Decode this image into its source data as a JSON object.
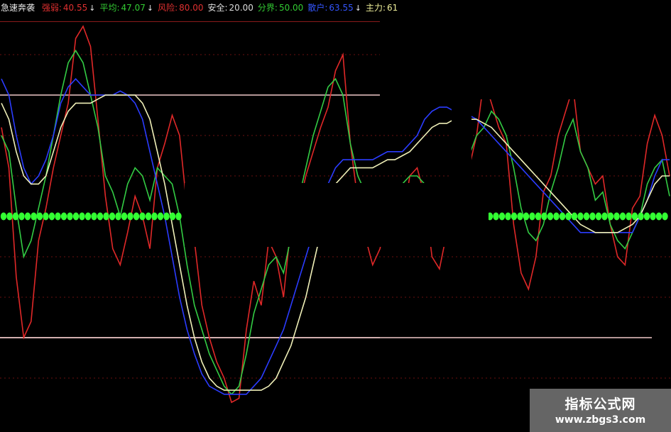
{
  "header": {
    "title": "急速奔袭",
    "items": [
      {
        "label": "强弱:",
        "value": "40.55",
        "color": "#e03030",
        "arrow": "↓"
      },
      {
        "label": "平均:",
        "value": "47.07",
        "color": "#33cc33",
        "arrow": "↓"
      },
      {
        "label": "风险:",
        "value": "80.00",
        "color": "#e03030",
        "arrow": ""
      },
      {
        "label": "安全:",
        "value": "20.00",
        "color": "#dddddd",
        "arrow": ""
      },
      {
        "label": "分界:",
        "value": "50.00",
        "color": "#33cc33",
        "arrow": ""
      },
      {
        "label": "散户:",
        "value": "63.55",
        "color": "#3355ff",
        "arrow": "↓"
      },
      {
        "label": "主力:",
        "value": "61",
        "color": "#eeee99",
        "arrow": ""
      }
    ]
  },
  "watermark": {
    "line1": "指标公式网",
    "line2": "www.zbgs3.com"
  },
  "chart_data": {
    "type": "line",
    "ylim": [
      0,
      100
    ],
    "reference_lines": [
      {
        "name": "风险",
        "value": 80,
        "color": "#f0c8c8"
      },
      {
        "name": "安全",
        "value": 20,
        "color": "#f0c8c8"
      },
      {
        "name": "分界",
        "value": 50,
        "color": "#33ff33",
        "style": "dots"
      }
    ],
    "x": [
      0,
      1,
      2,
      3,
      4,
      5,
      6,
      7,
      8,
      9,
      10,
      11,
      12,
      13,
      14,
      15,
      16,
      17,
      18,
      19,
      20,
      21,
      22,
      23,
      24,
      25,
      26,
      27,
      28,
      29,
      30,
      31,
      32,
      33,
      34,
      35,
      36,
      37,
      38,
      39,
      40,
      41,
      42,
      43,
      44,
      45,
      46,
      47,
      48,
      49,
      50,
      51,
      52,
      53,
      54,
      55,
      56,
      57,
      58,
      59,
      60,
      61,
      62,
      63,
      64,
      65,
      66,
      67,
      68,
      69,
      70,
      71,
      72,
      73,
      74,
      75,
      76,
      77,
      78,
      79,
      80,
      81,
      82,
      83,
      84,
      85,
      86,
      87,
      88,
      89,
      90
    ],
    "series": [
      {
        "name": "强弱",
        "color": "#e02828",
        "values": [
          null,
          null,
          null,
          null,
          null,
          null,
          null,
          null,
          null,
          null,
          null,
          null,
          null,
          null,
          null,
          null,
          null,
          null,
          null,
          null,
          null,
          null,
          null,
          null,
          null,
          null,
          null,
          null,
          null,
          null,
          null,
          null,
          null,
          null,
          null,
          null,
          null,
          null,
          null,
          null,
          null,
          null,
          null,
          null,
          null,
          null,
          null,
          null,
          null,
          null,
          null,
          null,
          null,
          null,
          null,
          null,
          null,
          null,
          null,
          null,
          null,
          null,
          null,
          null,
          null,
          null,
          null,
          null,
          null,
          null,
          null,
          null,
          null,
          null,
          null,
          null,
          null,
          null,
          null,
          null,
          null,
          null,
          null,
          null,
          null,
          null,
          null,
          null,
          null,
          null,
          null
        ]
      },
      {
        "name": "平均",
        "color": "#33cc44",
        "values": []
      },
      {
        "name": "散户",
        "color": "#2b3cff",
        "values": []
      },
      {
        "name": "主力",
        "color": "#f0f0b8",
        "values": []
      }
    ]
  }
}
